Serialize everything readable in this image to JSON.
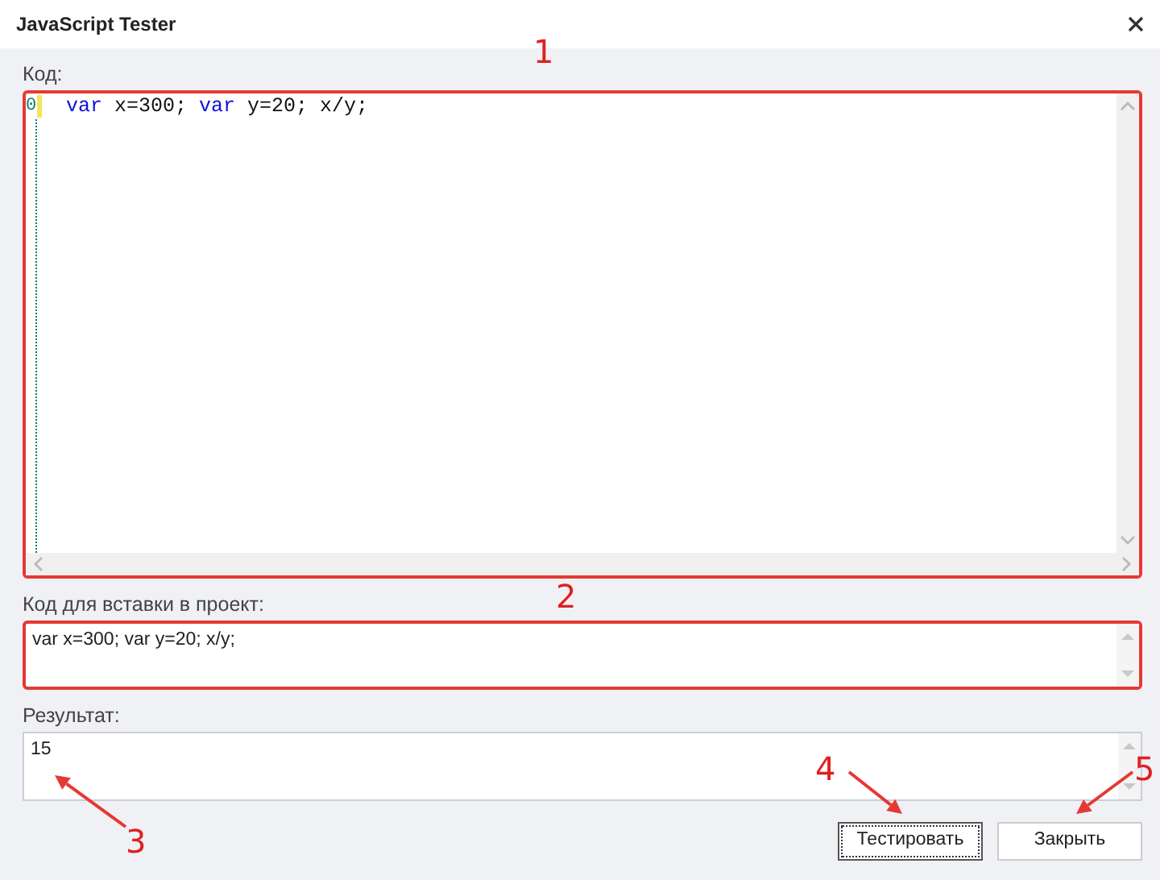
{
  "window": {
    "title": "JavaScript Tester"
  },
  "code_editor": {
    "label": "Код:",
    "highlighted": true,
    "lines": [
      {
        "number": "0",
        "tokens": [
          {
            "kind": "keyword",
            "text": "var"
          },
          {
            "kind": "plain",
            "text": " x=300; "
          },
          {
            "kind": "keyword",
            "text": "var"
          },
          {
            "kind": "plain",
            "text": " y=20; x/y;"
          }
        ]
      }
    ]
  },
  "insert_code": {
    "label": "Код для вставки в проект:",
    "highlighted": true,
    "value": "var x=300; var y=20; x/y;"
  },
  "result": {
    "label": "Результат:",
    "highlighted": false,
    "value": "15"
  },
  "buttons": [
    {
      "label": "Тестировать",
      "focused": true
    },
    {
      "label": "Закрыть",
      "focused": false
    }
  ],
  "annotations": [
    {
      "label": "1"
    },
    {
      "label": "2"
    },
    {
      "label": "3"
    },
    {
      "label": "4"
    },
    {
      "label": "5"
    }
  ]
}
